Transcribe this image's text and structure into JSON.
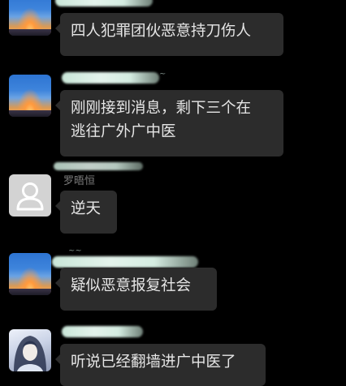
{
  "messages": [
    {
      "avatar": "sunset-sky-avatar",
      "sender": "",
      "lines": [
        "四人犯罪团伙恶意持刀伤人"
      ]
    },
    {
      "avatar": "sunset-sky-avatar",
      "sender": "",
      "lines": [
        "刚刚接到消息，剩下三个在",
        "逃往广外广中医"
      ]
    },
    {
      "avatar": "default-user-avatar",
      "sender": "罗晤恒",
      "lines": [
        "逆天"
      ]
    },
    {
      "avatar": "sunset-sky-avatar",
      "sender": "",
      "lines": [
        "疑似恶意报复社会"
      ]
    },
    {
      "avatar": "anime-character-avatar",
      "sender": "",
      "lines": [
        "听说已经翻墙进广中医了"
      ]
    }
  ],
  "colors": {
    "background": "#000000",
    "bubble": "#2c2c2c",
    "text": "#e6e6e6",
    "sender_name": "#7d7d7d"
  }
}
